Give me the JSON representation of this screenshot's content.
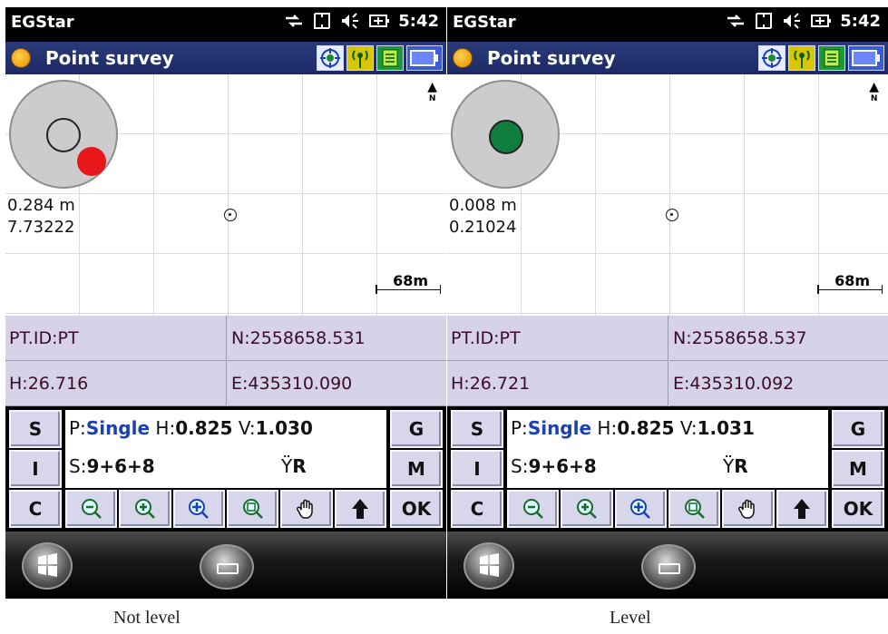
{
  "panels": [
    {
      "status": {
        "app": "EGStar",
        "time": "5:42"
      },
      "title": "Point survey",
      "readout": {
        "distance": "0.284 m",
        "angle": "7.73222"
      },
      "scale": "68m",
      "north": "N",
      "info": {
        "pt_id": "PT.ID:PT",
        "north": "N:2558658.531",
        "height": "H:26.716",
        "east": "E:435310.090"
      },
      "solution": {
        "p_label": "P:",
        "mode": "Single",
        "h_label": "H:",
        "h_value": "0.825",
        "v_label": "V:",
        "v_value": "1.030",
        "s_label": "S:",
        "sats": "9+6+8",
        "r_label": "R"
      },
      "buttons": {
        "s": "S",
        "i": "I",
        "c": "C",
        "g": "G",
        "m": "M",
        "ok": "OK"
      },
      "caption": "Not level",
      "bubble_color": "#e8171b"
    },
    {
      "status": {
        "app": "EGStar",
        "time": "5:42"
      },
      "title": "Point survey",
      "readout": {
        "distance": "0.008 m",
        "angle": "0.21024"
      },
      "scale": "68m",
      "north": "N",
      "info": {
        "pt_id": "PT.ID:PT",
        "north": "N:2558658.537",
        "height": "H:26.721",
        "east": "E:435310.092"
      },
      "solution": {
        "p_label": "P:",
        "mode": "Single",
        "h_label": "H:",
        "h_value": "0.825",
        "v_label": "V:",
        "v_value": "1.031",
        "s_label": "S:",
        "sats": "9+6+8",
        "r_label": "R"
      },
      "buttons": {
        "s": "S",
        "i": "I",
        "c": "C",
        "g": "G",
        "m": "M",
        "ok": "OK"
      },
      "caption": "Level",
      "bubble_color": "#0e7e3f"
    }
  ],
  "icons": [
    "connection-icon",
    "sync-icon",
    "volume-icon",
    "battery-icon",
    "gps-target-icon",
    "radio-signal-icon",
    "memory-icon",
    "battery-status-icon",
    "zoom-out-icon",
    "zoom-in-icon",
    "zoom-extent-icon",
    "zoom-window-icon",
    "pan-hand-icon",
    "up-arrow-icon",
    "windows-start-icon",
    "keyboard-icon"
  ]
}
